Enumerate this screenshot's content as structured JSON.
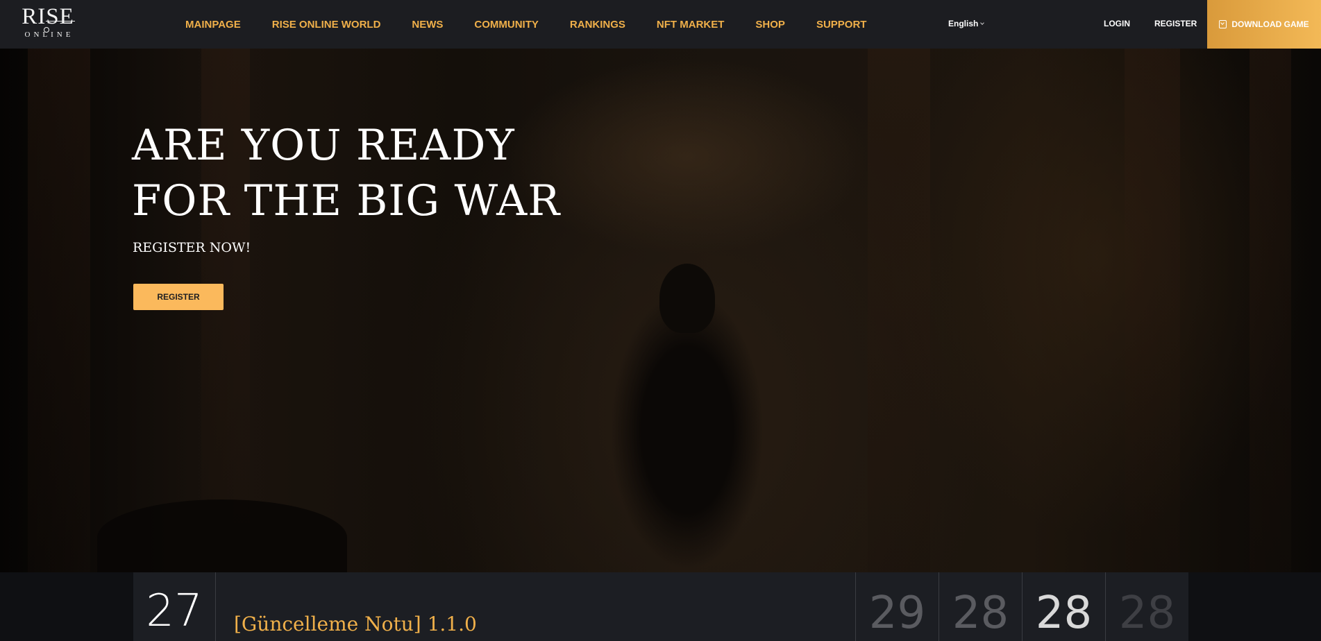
{
  "header": {
    "logo": {
      "main": "RISE",
      "sub": "ONLINE"
    },
    "nav": [
      {
        "label": "MAINPAGE"
      },
      {
        "label": "RISE ONLINE WORLD"
      },
      {
        "label": "NEWS"
      },
      {
        "label": "COMMUNITY"
      },
      {
        "label": "RANKINGS"
      },
      {
        "label": "NFT MARKET"
      },
      {
        "label": "SHOP"
      },
      {
        "label": "SUPPORT"
      }
    ],
    "language": "English",
    "login_label": "LOGIN",
    "register_label": "REGISTER",
    "download_label": "DOWNLOAD GAME",
    "colors": {
      "nav_accent": "#f0b04a",
      "download_bg": "#f3b957",
      "header_bg": "#1c1d21"
    }
  },
  "hero": {
    "title_line1": "ARE YOU READY",
    "title_line2": "FOR THE BIG WAR",
    "subtitle": "REGISTER NOW!",
    "button_label": "REGISTER",
    "button_color": "#fbb95c"
  },
  "news": {
    "day": "27",
    "title": "[Güncelleme Notu] 1.1.0",
    "counters": [
      {
        "value": "29",
        "color": "#5a5b60"
      },
      {
        "value": "28",
        "color": "#5a5b60"
      },
      {
        "value": "28",
        "color": "#d9d9d9"
      },
      {
        "value": "28",
        "color": "#3e3f44"
      }
    ]
  }
}
